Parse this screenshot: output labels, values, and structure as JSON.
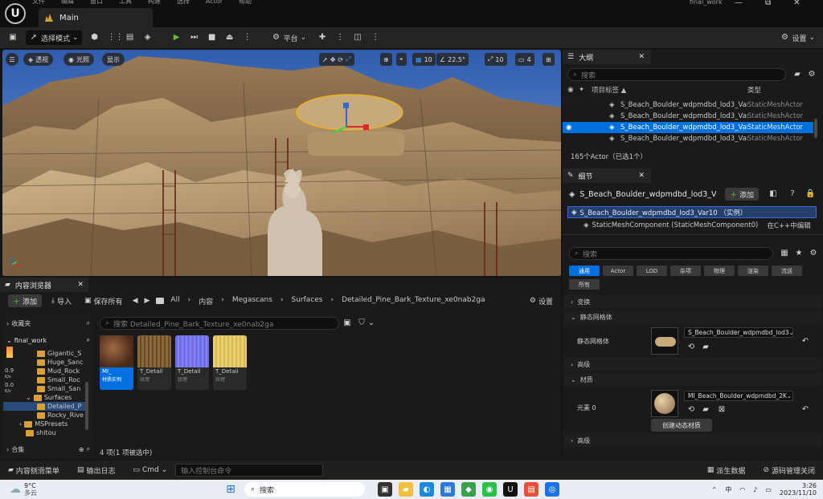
{
  "titlebar": {
    "logo": "U",
    "menu": [
      "文件",
      "编辑",
      "窗口",
      "工具",
      "构建",
      "选择",
      "Actor",
      "帮助"
    ],
    "tab": "Main",
    "project": "final_work",
    "window_controls": [
      "—",
      "⧉",
      "✕"
    ]
  },
  "toolbar": {
    "mode_label": "选择模式",
    "platform_label": "平台",
    "settings_label": "设置"
  },
  "viewport": {
    "perspective": "透视",
    "lit": "光照",
    "show": "显示",
    "grid_value": "10",
    "angle_value": "22.5°",
    "scale_value": "10",
    "camera_speed": "4"
  },
  "outliner": {
    "tab": "大纲",
    "search_placeholder": "搜索",
    "col_label": "项目标签 ▲",
    "col_type": "类型",
    "rows": [
      {
        "label": "S_Beach_Boulder_wdpmdbd_lod3_Var",
        "type": "StaticMeshActor"
      },
      {
        "label": "S_Beach_Boulder_wdpmdbd_lod3_Var",
        "type": "StaticMeshActor"
      },
      {
        "label": "S_Beach_Boulder_wdpmdbd_lod3_Var",
        "type": "StaticMeshActor"
      },
      {
        "label": "S_Beach_Boulder_wdpmdbd_lod3_Var",
        "type": "StaticMeshActor"
      }
    ],
    "selected_index": 2,
    "count": "165个Actor（已选1个）"
  },
  "details": {
    "tab": "细节",
    "actor_name": "S_Beach_Boulder_wdpmdbd_lod3_V",
    "add_label": "添加",
    "instance_label": "S_Beach_Boulder_wdpmdbd_lod3_Var10 （实例）",
    "component_label": "StaticMeshComponent (StaticMeshComponent0)",
    "edit_cpp": "在C++中编辑",
    "search_placeholder": "搜索",
    "filters": [
      "通用",
      "Actor",
      "LOD",
      "杂项",
      "物理",
      "渲染",
      "流送"
    ],
    "filter_all": "所有",
    "sec_transform": "变换",
    "sec_static_mesh": "静态网格体",
    "static_mesh_label": "静态网格体",
    "static_mesh_value": "S_Beach_Boulder_wdpmdbd_lod3",
    "sec_advanced1": "高级",
    "sec_materials": "材质",
    "element_label": "元素 0",
    "material_value": "MI_Beach_Boulder_wdpmdbd_2K",
    "create_dynamic": "创建动态材质",
    "sec_advanced2": "高级"
  },
  "content_browser": {
    "tab": "内容浏览器",
    "add_label": "添加",
    "import_label": "导入",
    "save_all_label": "保存所有",
    "breadcrumb": [
      "All",
      "内容",
      "Megascans",
      "Surfaces",
      "Detailed_Pine_Bark_Texture_xe0nab2ga"
    ],
    "settings_label": "设置",
    "favorites": "收藏夹",
    "project_root": "final_work",
    "search_placeholder": "搜索 Detailed_Pine_Bark_Texture_xe0nab2ga",
    "tree": [
      {
        "label": "Gigantic_S",
        "indent": 0
      },
      {
        "label": "Huge_Sanc",
        "indent": 0
      },
      {
        "label": "Mud_Rock",
        "indent": 0
      },
      {
        "label": "Small_Roc",
        "indent": 0
      },
      {
        "label": "Small_San",
        "indent": 0
      },
      {
        "label": "Surfaces",
        "indent": 1
      },
      {
        "label": "Detailed_P",
        "indent": 2
      },
      {
        "label": "Rocky_Rive",
        "indent": 2
      },
      {
        "label": "MSPresets",
        "indent": 1
      },
      {
        "label": "shitou",
        "indent": 1
      }
    ],
    "stats": [
      {
        "value": "0.9",
        "unit": "K/s"
      },
      {
        "value": "0.0",
        "unit": "K/s"
      }
    ],
    "collections": "合集",
    "assets": [
      {
        "name": "MI_",
        "sub": "材质实例",
        "color": "#7a4a2a"
      },
      {
        "name": "T_Detail",
        "sub": "纹理",
        "color": "#8a6a3a"
      },
      {
        "name": "T_Detail",
        "sub": "纹理",
        "color": "#6a70e8"
      },
      {
        "name": "T_Detail",
        "sub": "纹理",
        "color": "#e8d070"
      }
    ],
    "item_count": "4 项(1 项被选中)"
  },
  "statusbar": {
    "drawer": "内容侧滑菜单",
    "output_log": "输出日志",
    "cmd": "Cmd",
    "console_placeholder": "输入控制台命令",
    "derived_data": "派生数据",
    "source_control": "源码管理关闭"
  },
  "taskbar": {
    "temp": "9°C",
    "weather": "多云",
    "search": "搜索",
    "time": "3:26",
    "date": "2023/11/10",
    "ime": "中"
  },
  "colors": {
    "accent": "#0070e0",
    "play": "#5fbf3b",
    "folder": "#d9a035"
  }
}
